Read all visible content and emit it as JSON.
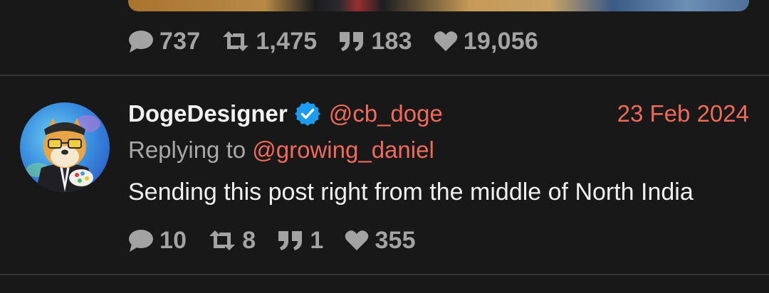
{
  "previous_post": {
    "stats": {
      "replies": "737",
      "reposts": "1,475",
      "quotes": "183",
      "likes": "19,056"
    }
  },
  "post": {
    "author_name": "DogeDesigner",
    "handle": "@cb_doge",
    "date": "23 Feb 2024",
    "replying_prefix": "Replying to",
    "replying_to": "@growing_daniel",
    "text": "Sending this post right from the middle of North India",
    "stats": {
      "replies": "10",
      "reposts": "8",
      "quotes": "1",
      "likes": "355"
    }
  },
  "colors": {
    "background": "#181818",
    "accent": "#f06a5a",
    "muted": "#a3a3a3",
    "verified": "#1d9bf0"
  },
  "icons": {
    "reply": "speech-bubble-icon",
    "repost": "repost-icon",
    "quote": "quote-icon",
    "like": "heart-icon",
    "verified": "verified-badge-icon"
  }
}
